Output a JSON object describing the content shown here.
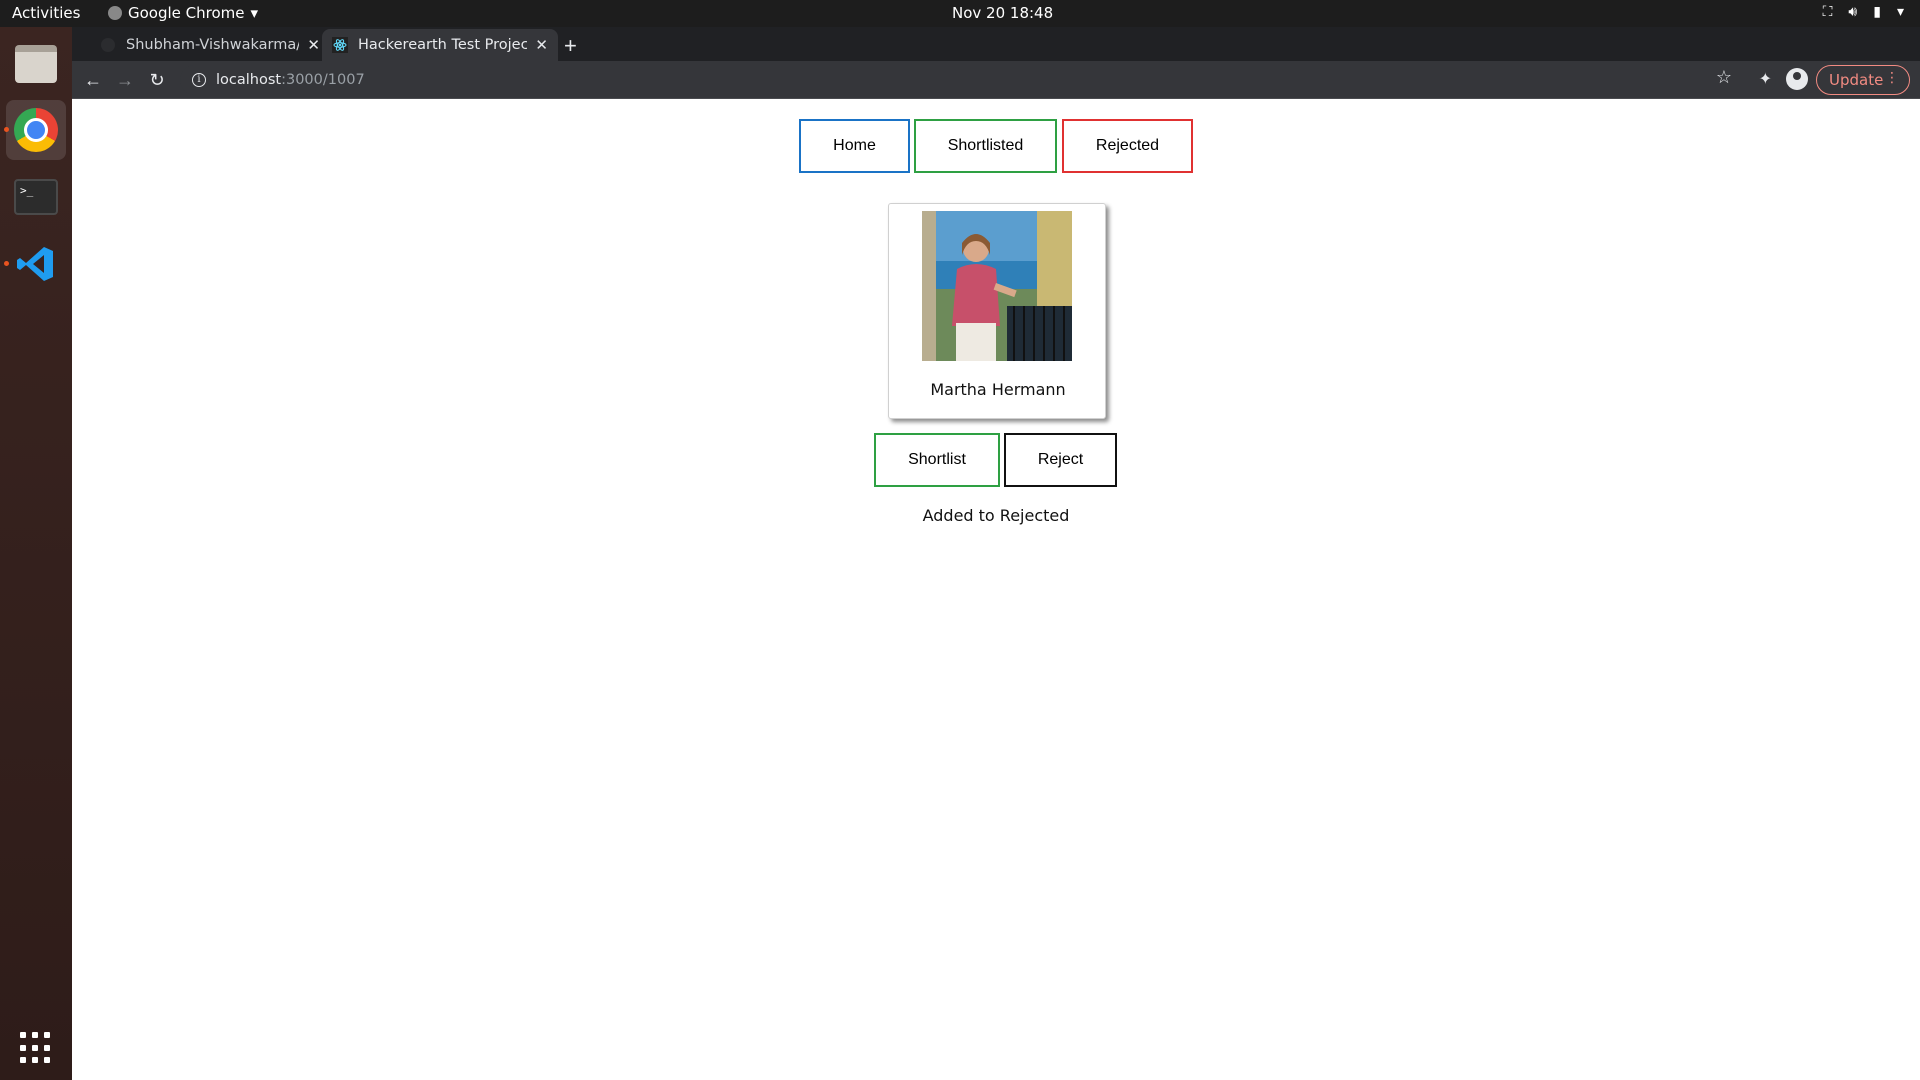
{
  "system": {
    "activities": "Activities",
    "app_name": "Google Chrome",
    "clock": "Nov 20  18:48"
  },
  "browser": {
    "tabs": [
      {
        "title": "Shubham-Vishwakarma/F",
        "active": false
      },
      {
        "title": "Hackerearth Test Project",
        "active": true
      }
    ],
    "url_host": "localhost",
    "url_path": ":3000/1007",
    "update_label": "Update"
  },
  "page": {
    "nav": {
      "home_label": "Home",
      "shortlisted_label": "Shortlisted",
      "rejected_label": "Rejected"
    },
    "profile": {
      "name": "Martha Hermann"
    },
    "actions": {
      "shortlist_label": "Shortlist",
      "reject_label": "Reject"
    },
    "status_message": "Added to Rejected"
  },
  "colors": {
    "home_border": "#1a73c6",
    "shortlist_border": "#2ea043",
    "reject_border": "#e03131"
  }
}
